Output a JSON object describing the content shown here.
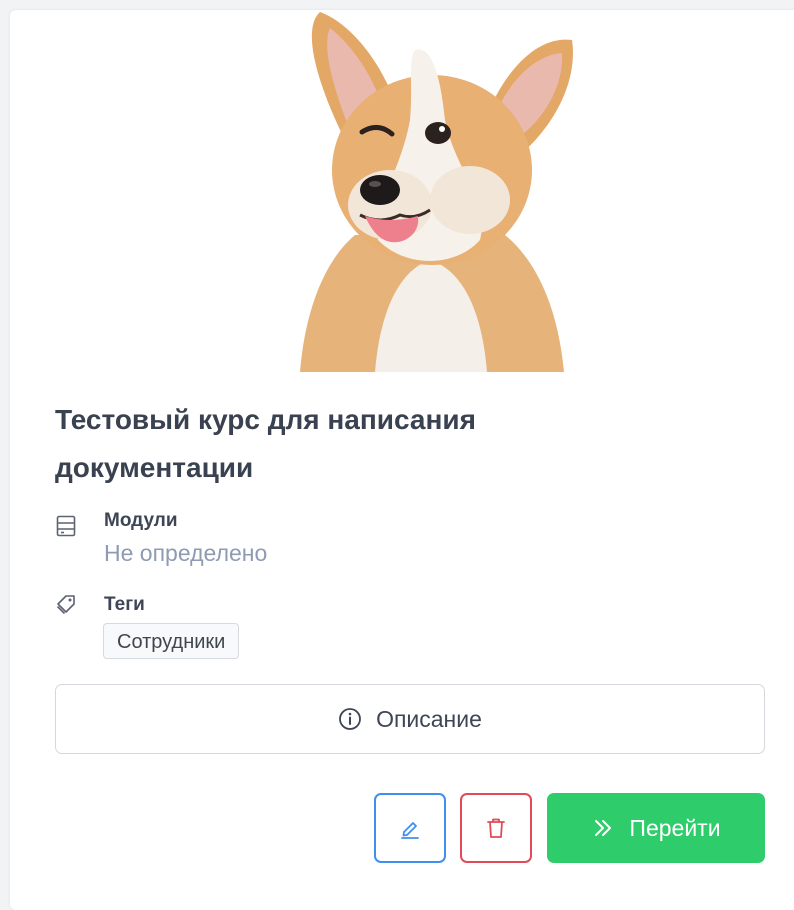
{
  "course": {
    "title": "Тестовый курс для написания документации",
    "modules": {
      "label": "Модули",
      "value": "Не определено",
      "icon": "modules-icon"
    },
    "tags": {
      "label": "Теги",
      "icon": "tag-icon",
      "items": [
        "Сотрудники"
      ]
    }
  },
  "actions": {
    "description_label": "Описание",
    "go_label": "Перейти",
    "edit_icon": "pencil-icon",
    "delete_icon": "trash-icon"
  },
  "colors": {
    "primary_blue": "#3f8ff0",
    "danger_red": "#e04b57",
    "success_green": "#2fcc6b",
    "title_text": "#3a4150",
    "muted_text": "#8f9bb3"
  }
}
